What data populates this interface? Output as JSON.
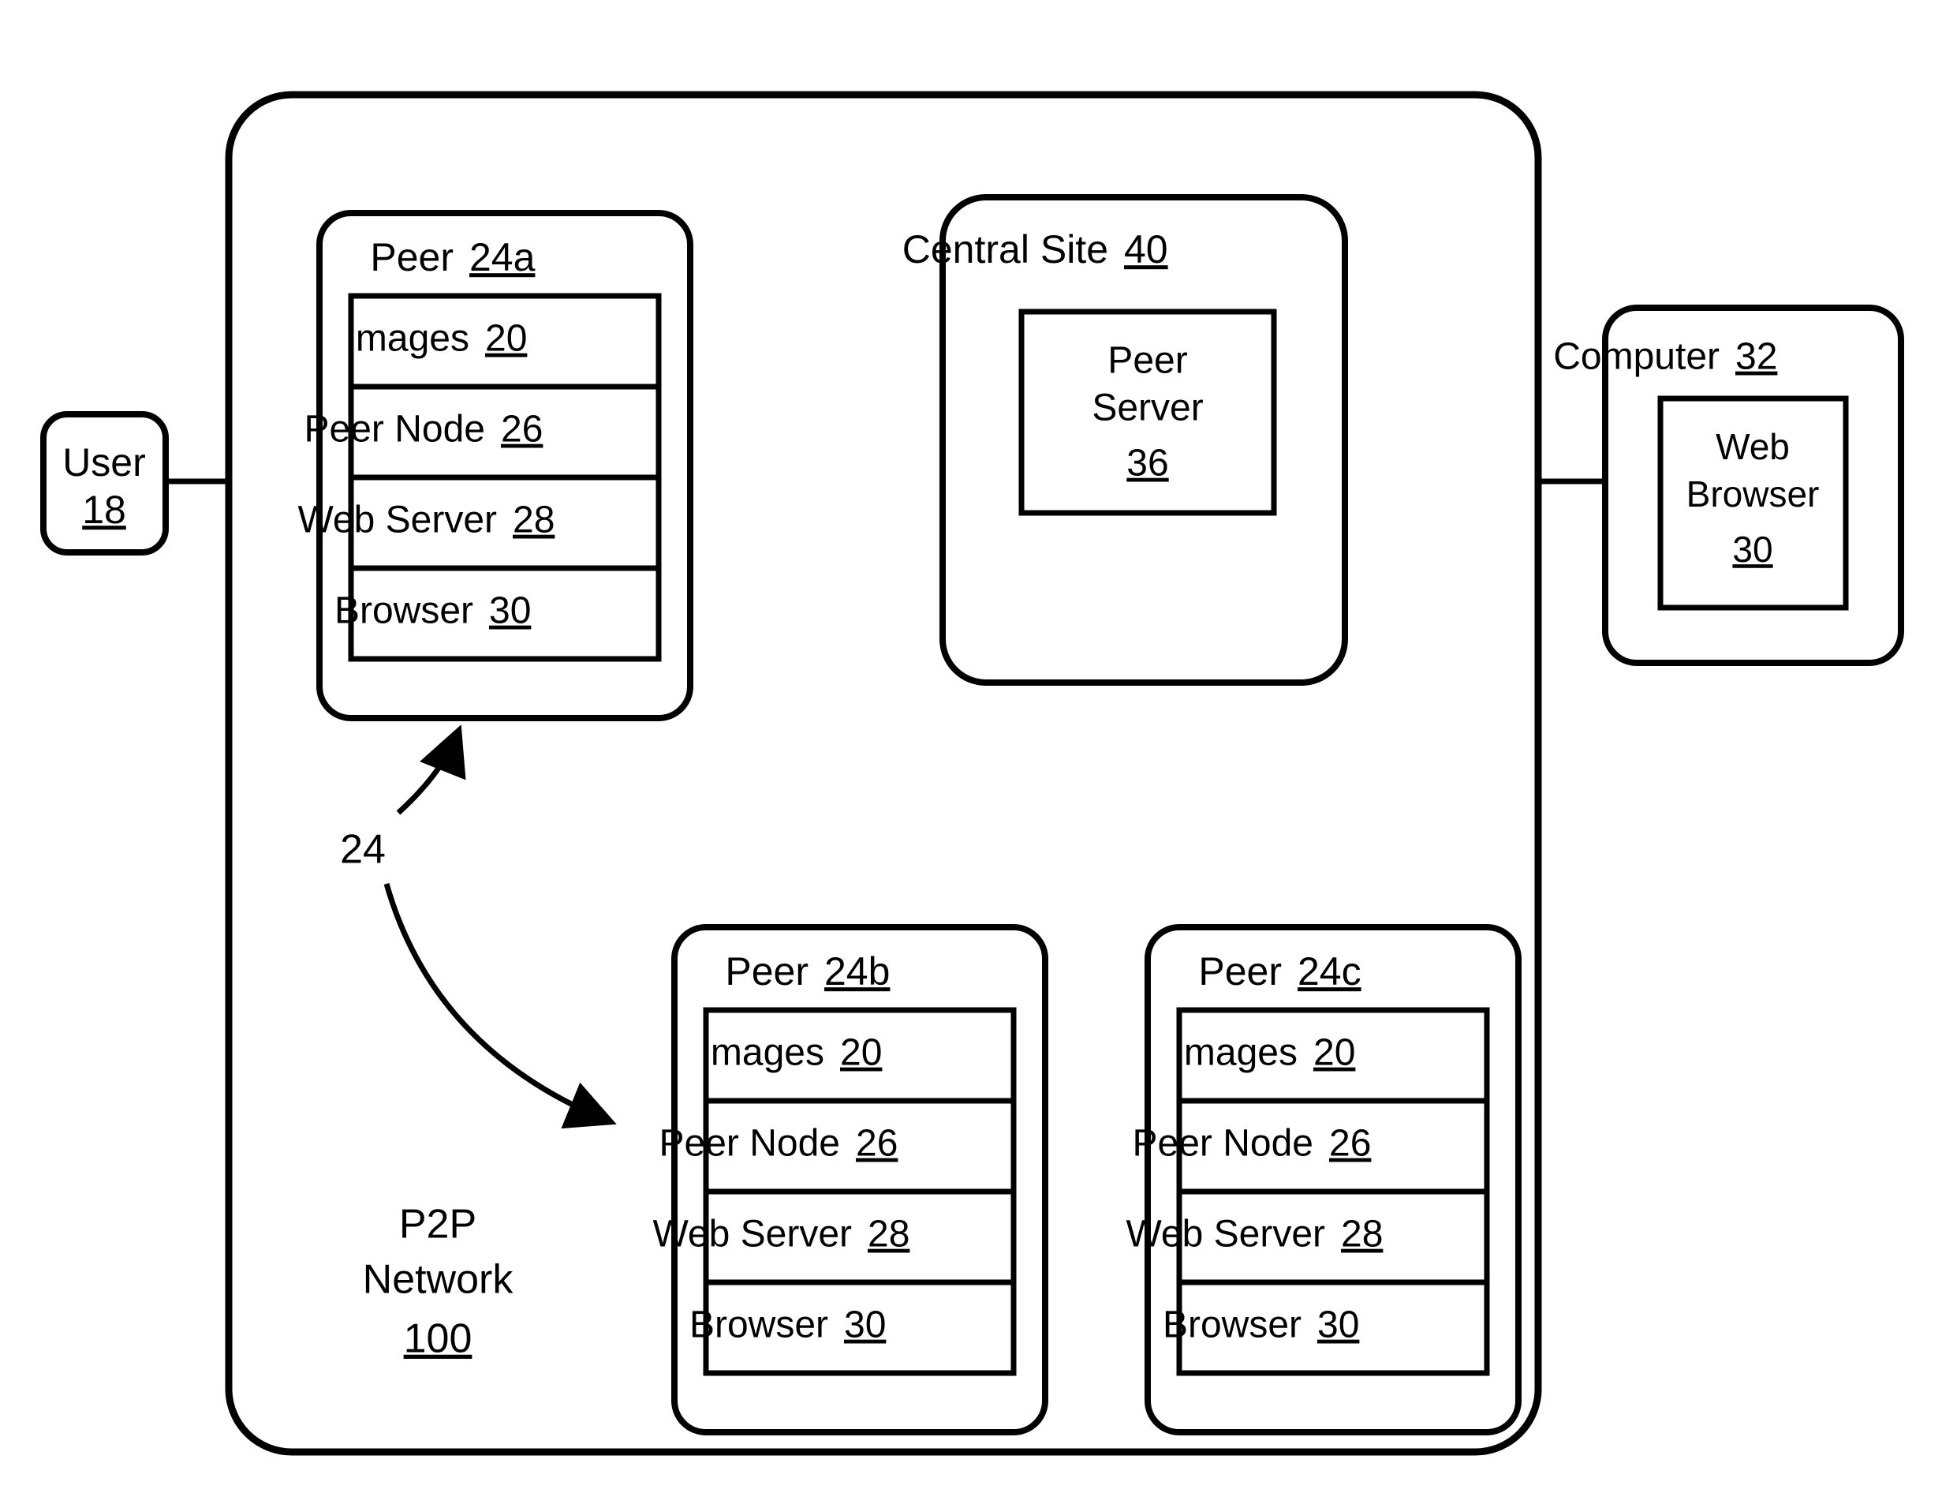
{
  "user": {
    "label": "User",
    "ref": "18"
  },
  "network": {
    "label1": "P2P",
    "label2": "Network",
    "ref": "100"
  },
  "peerA": {
    "title": "Peer",
    "ref": "24a",
    "rows": [
      {
        "label": "Images",
        "ref": "20"
      },
      {
        "label": "Peer Node",
        "ref": "26"
      },
      {
        "label": "Web Server",
        "ref": "28"
      },
      {
        "label": "Browser",
        "ref": "30"
      }
    ]
  },
  "peerB": {
    "title": "Peer",
    "ref": "24b",
    "rows": [
      {
        "label": "Images",
        "ref": "20"
      },
      {
        "label": "Peer Node",
        "ref": "26"
      },
      {
        "label": "Web Server",
        "ref": "28"
      },
      {
        "label": "Browser",
        "ref": "30"
      }
    ]
  },
  "peerC": {
    "title": "Peer",
    "ref": "24c",
    "rows": [
      {
        "label": "Images",
        "ref": "20"
      },
      {
        "label": "Peer Node",
        "ref": "26"
      },
      {
        "label": "Web Server",
        "ref": "28"
      },
      {
        "label": "Browser",
        "ref": "30"
      }
    ]
  },
  "central": {
    "title": "Central Site",
    "ref": "40",
    "peerServer": {
      "label1": "Peer",
      "label2": "Server",
      "ref": "36"
    }
  },
  "computer": {
    "title": "Computer",
    "ref": "32",
    "webBrowser": {
      "label1": "Web",
      "label2": "Browser",
      "ref": "30"
    }
  },
  "callout": "24"
}
